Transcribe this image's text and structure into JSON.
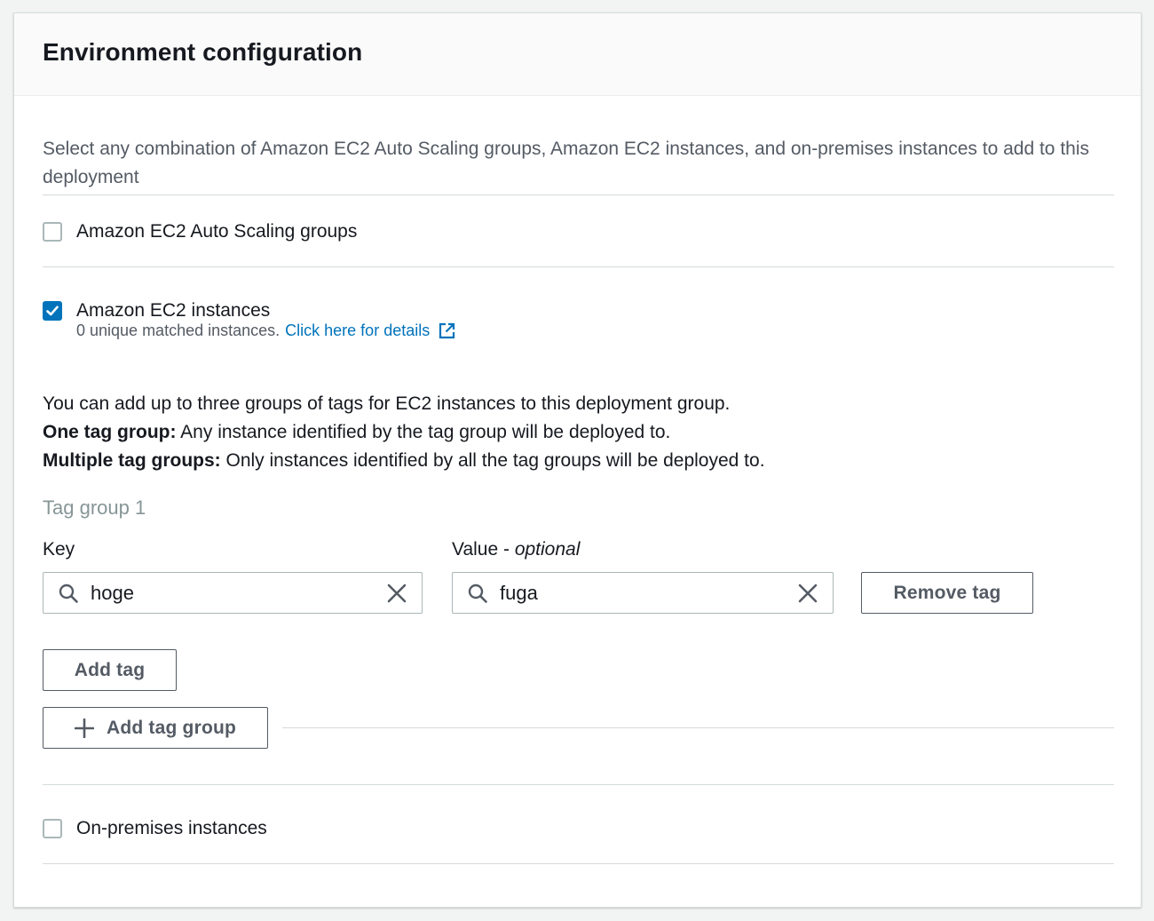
{
  "panel": {
    "title": "Environment configuration",
    "description": "Select any combination of Amazon EC2 Auto Scaling groups, Amazon EC2 instances, and on-premises instances to add to this deployment"
  },
  "options": {
    "auto_scaling": {
      "label": "Amazon EC2 Auto Scaling groups",
      "checked": false
    },
    "ec2_instances": {
      "label": "Amazon EC2 instances",
      "checked": true
    },
    "on_premises": {
      "label": "On-premises instances",
      "checked": false
    }
  },
  "ec2": {
    "matched_text": "0 unique matched instances.",
    "details_link": "Click here for details"
  },
  "info": {
    "line1": "You can add up to three groups of tags for EC2 instances to this deployment group.",
    "one_tag_group_bold": "One tag group:",
    "one_tag_group_text": " Any instance identified by the tag group will be deployed to.",
    "multi_tag_group_bold": "Multiple tag groups:",
    "multi_tag_group_text": " Only instances identified by all the tag groups will be deployed to."
  },
  "tag_group": {
    "title": "Tag group 1",
    "key_label": "Key",
    "value_label_prefix": "Value - ",
    "value_label_optional": "optional",
    "key_value": "hoge",
    "value_value": "fuga",
    "remove_tag_label": "Remove tag",
    "add_tag_label": "Add tag",
    "add_tag_group_label": "Add tag group"
  },
  "colors": {
    "accent": "#0073bb",
    "text": "#16191f",
    "muted": "#545b64",
    "border": "#aab7b8"
  }
}
